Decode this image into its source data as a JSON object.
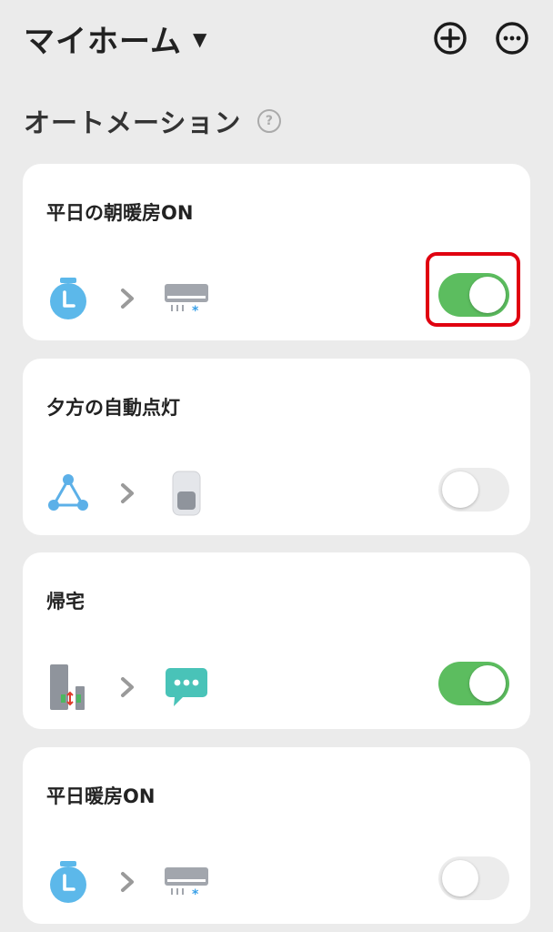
{
  "header": {
    "home_name": "マイホーム",
    "caret": "▼",
    "add_icon": "plus-circle-icon",
    "more_icon": "ellipsis-circle-icon"
  },
  "section": {
    "title": "オートメーション",
    "help_glyph": "?"
  },
  "automations": [
    {
      "title": "平日の朝暖房ON",
      "trigger_icon": "timer-icon",
      "action_icon": "air-conditioner-icon",
      "enabled": true,
      "highlighted": true
    },
    {
      "title": "夕方の自動点灯",
      "trigger_icon": "scene-triangle-icon",
      "action_icon": "switch-icon",
      "enabled": false
    },
    {
      "title": "帰宅",
      "trigger_icon": "contact-sensor-icon",
      "action_icon": "message-icon",
      "enabled": true
    },
    {
      "title": "平日暖房ON",
      "trigger_icon": "timer-icon",
      "action_icon": "air-conditioner-icon",
      "enabled": false
    }
  ],
  "colors": {
    "toggle_on": "#5cbd5f",
    "toggle_off": "#ececec",
    "highlight": "#e00010",
    "timer": "#5cb8ea",
    "message": "#49c3b8"
  }
}
